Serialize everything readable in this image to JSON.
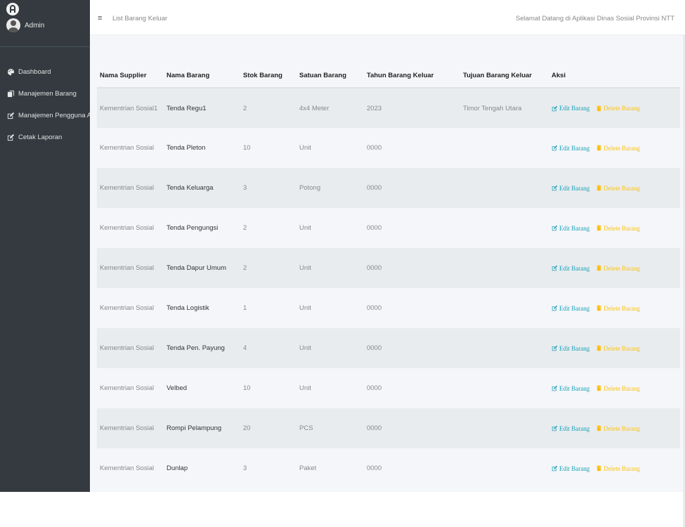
{
  "sidebar": {
    "user": "Admin",
    "items": [
      {
        "label": "Dashboard",
        "icon": "palette-icon"
      },
      {
        "label": "Manajemen Barang",
        "icon": "copy-icon"
      },
      {
        "label": "Manajemen Pengguna Aplikasi",
        "icon": "edit-icon"
      },
      {
        "label": "Cetak Laporan",
        "icon": "edit-icon"
      }
    ]
  },
  "header": {
    "menu_icon": "≡",
    "title": "List Barang Keluar",
    "welcome": "Selamat Datang di Aplikasi Dinas Sosial Provinsi NTT"
  },
  "table": {
    "columns": [
      "Nama Supplier",
      "Nama Barang",
      "Stok Barang",
      "Satuan Barang",
      "Tahun Barang Keluar",
      "Tujuan Barang Keluar",
      "Aksi"
    ],
    "edit_label": "Edit Barang",
    "delete_label": "Delete Barang",
    "rows": [
      [
        "Kementrian Sosial1",
        "Tenda Regu1",
        "2",
        "4x4 Meter",
        "2023",
        "Timor Tengah Utara"
      ],
      [
        "Kementrian Sosial",
        "Tenda Pleton",
        "10",
        "Unit",
        "0000",
        ""
      ],
      [
        "Kementrian Sosial",
        "Tenda Keluarga",
        "3",
        "Potong",
        "0000",
        ""
      ],
      [
        "Kementrian Sosial",
        "Tenda Pengungsi",
        "2",
        "Unit",
        "0000",
        ""
      ],
      [
        "Kementrian Sosial",
        "Tenda Dapur Umum",
        "2",
        "Unit",
        "0000",
        ""
      ],
      [
        "Kementrian Sosial",
        "Tenda Logistik",
        "1",
        "Unit",
        "0000",
        ""
      ],
      [
        "Kementrian Sosial",
        "Tenda Pen. Payung",
        "4",
        "Unit",
        "0000",
        ""
      ],
      [
        "Kementrian Sosial",
        "Velbed",
        "10",
        "Unit",
        "0000",
        ""
      ],
      [
        "Kementrian Sosial",
        "Rompi Pelampung",
        "20",
        "PCS",
        "0000",
        ""
      ],
      [
        "Kementrian Sosial",
        "Dunlap",
        "3",
        "Paket",
        "0000",
        ""
      ]
    ]
  },
  "colors": {
    "sidebar": "#343a40",
    "edit": "#17a2b8",
    "delete": "#ffc107"
  }
}
